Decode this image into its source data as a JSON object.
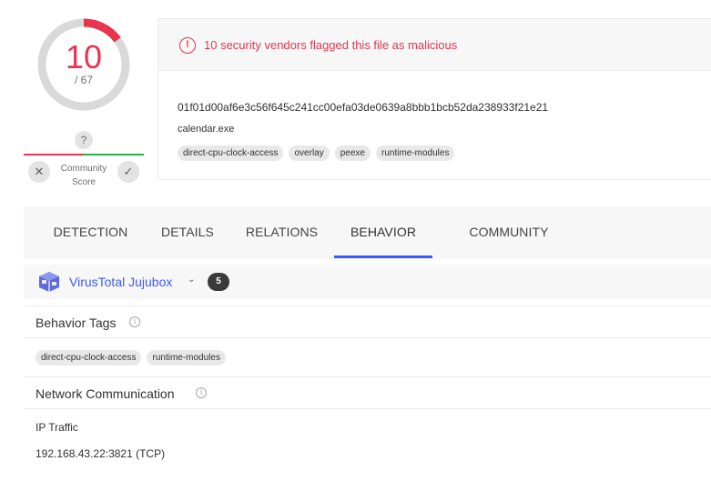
{
  "score": {
    "detections": "10",
    "total": "/ 67"
  },
  "community": {
    "unknown_glyph": "?",
    "label_line1": "Community",
    "label_line2": "Score"
  },
  "file": {
    "alert_icon": "!",
    "alert_text": "10 security vendors flagged this file as malicious",
    "hash": "01f01d00af6e3c56f645c241cc00efa03de0639a8bbb1bcb52da238933f21e21",
    "name": "calendar.exe",
    "tags": [
      "direct-cpu-clock-access",
      "overlay",
      "peexe",
      "runtime-modules"
    ]
  },
  "tabs": [
    {
      "label": "DETECTION",
      "active": false
    },
    {
      "label": "DETAILS",
      "active": false
    },
    {
      "label": "RELATIONS",
      "active": false
    },
    {
      "label": "BEHAVIOR",
      "active": true
    },
    {
      "label": "COMMUNITY",
      "active": false
    }
  ],
  "sandbox": {
    "name": "VirusTotal Jujubox",
    "count": "5",
    "icon": "cube-icon"
  },
  "behavior_tags": {
    "title": "Behavior Tags",
    "tags": [
      "direct-cpu-clock-access",
      "runtime-modules"
    ]
  },
  "network": {
    "title": "Network Communication",
    "subtitle": "IP Traffic",
    "entries": [
      "192.168.43.22:3821 (TCP)"
    ]
  },
  "colors": {
    "malicious": "#e8344e",
    "accent": "#3d5afe",
    "positive": "#2bb24c",
    "panel": "#f7f7f7"
  }
}
